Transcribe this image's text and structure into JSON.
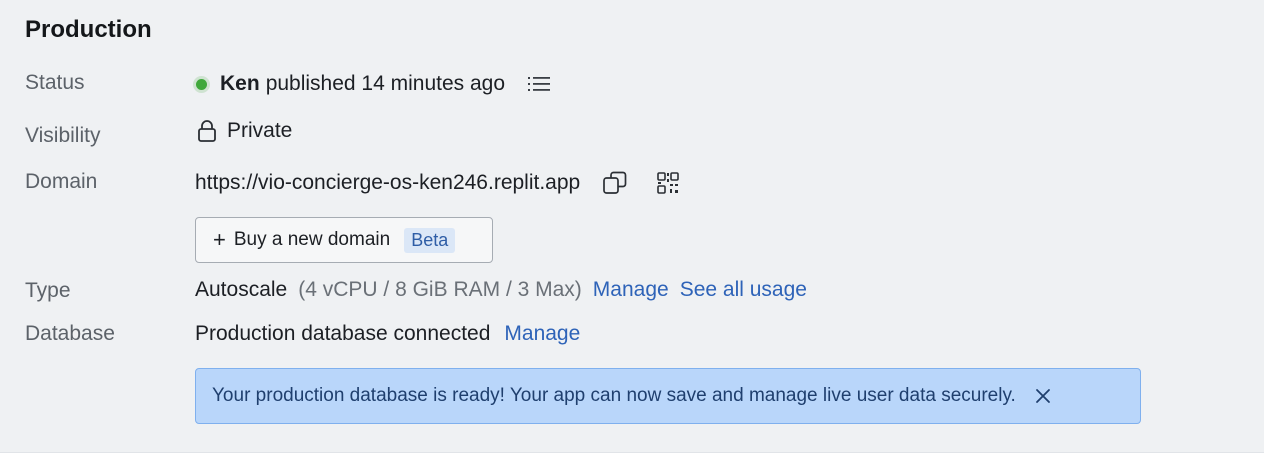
{
  "section": {
    "title": "Production"
  },
  "labels": {
    "status": "Status",
    "visibility": "Visibility",
    "domain": "Domain",
    "type": "Type",
    "database": "Database"
  },
  "status": {
    "user": "Ken",
    "text": "published 14 minutes ago",
    "dot_color": "#3fa83a",
    "icons": [
      "status-dot",
      "list-icon"
    ]
  },
  "visibility": {
    "value": "Private",
    "icon": "lock-icon"
  },
  "domain": {
    "url": "https://vio-concierge-os-ken246.replit.app",
    "icons": [
      "copy-icon",
      "qr-code-icon"
    ],
    "buy_button": {
      "label": "Buy a new domain",
      "badge": "Beta",
      "icon": "plus-icon"
    }
  },
  "type": {
    "value": "Autoscale",
    "detail": "(4 vCPU / 8 GiB RAM / 3 Max)",
    "manage_link": "Manage",
    "usage_link": "See all usage"
  },
  "database": {
    "value": "Production database connected",
    "manage_link": "Manage"
  },
  "banner": {
    "text": "Your production database is ready! Your app can now save and manage live user data securely.",
    "icon": "close-icon"
  },
  "colors": {
    "accent_link": "#2e63b8",
    "banner_bg": "#b9d6fa",
    "panel_bg": "#eff1f3"
  }
}
